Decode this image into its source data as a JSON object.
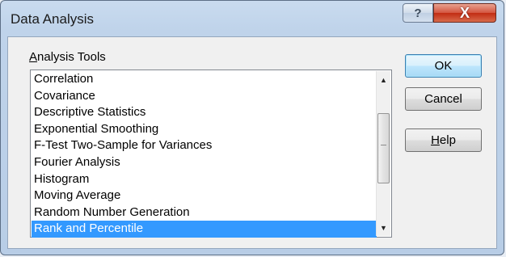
{
  "window": {
    "title": "Data Analysis"
  },
  "caption_buttons": {
    "help": "?",
    "close": "X"
  },
  "group": {
    "label_accel": "A",
    "label_rest": "nalysis Tools"
  },
  "tools": [
    "Correlation",
    "Covariance",
    "Descriptive Statistics",
    "Exponential Smoothing",
    "F-Test Two-Sample for Variances",
    "Fourier Analysis",
    "Histogram",
    "Moving Average",
    "Random Number Generation",
    "Rank and Percentile"
  ],
  "selected_tool": "Rank and Percentile",
  "buttons": {
    "ok": "OK",
    "cancel": "Cancel",
    "help_accel": "H",
    "help_rest": "elp"
  },
  "colors": {
    "selection": "#3399ff",
    "close_button": "#c22c13"
  }
}
